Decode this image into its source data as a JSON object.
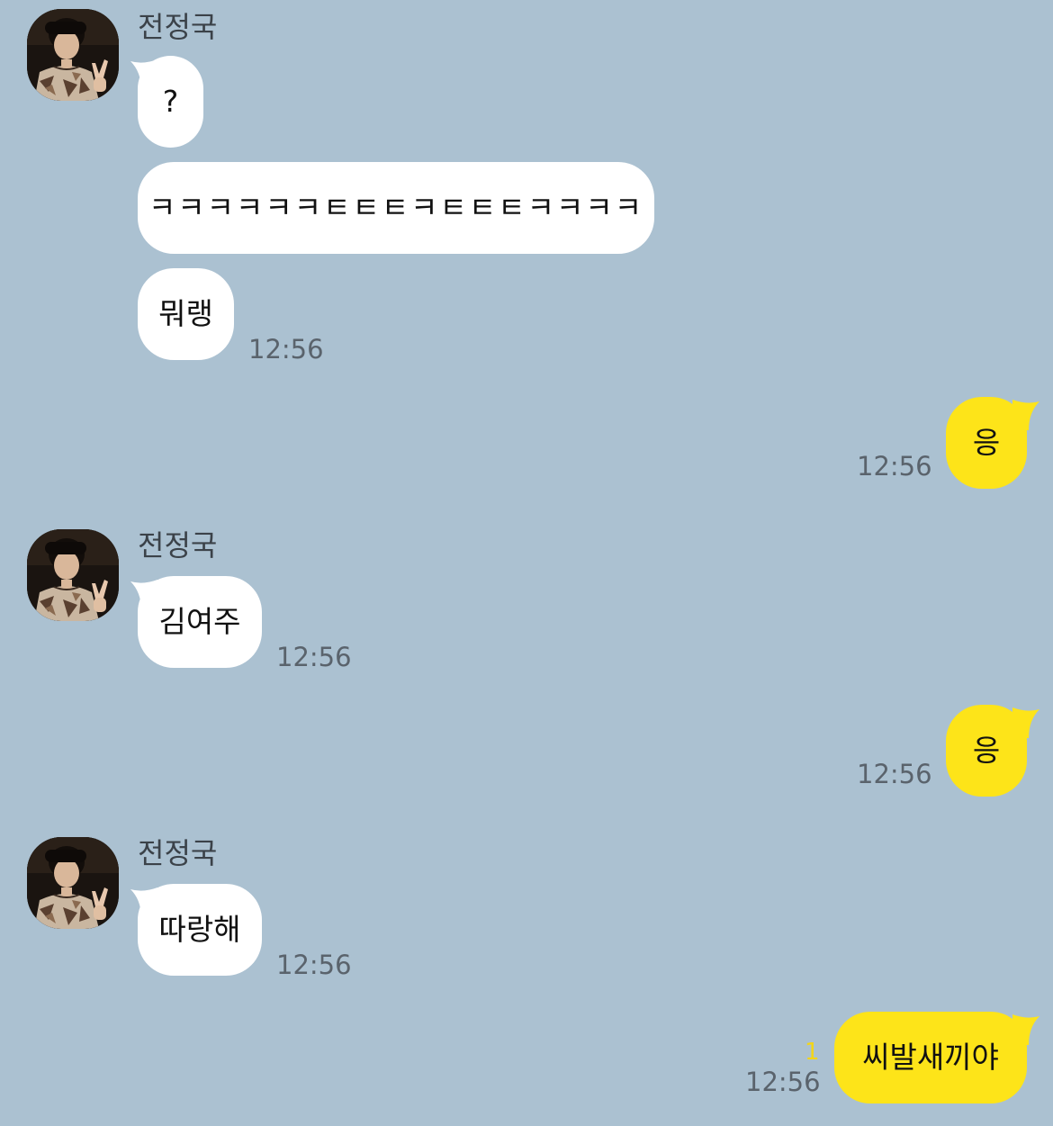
{
  "chat": {
    "sender_name": "전정국",
    "messages": [
      {
        "text": "?"
      },
      {
        "text": "ㅋㅋㅋㅋㅋㅋㅌㅌㅌㅋㅌㅌㅌㅋㅋㅋㅋ"
      },
      {
        "text": "뭐랭",
        "time": "12:56"
      },
      {
        "text": "응",
        "time": "12:56"
      },
      {
        "text": "김여주",
        "time": "12:56"
      },
      {
        "text": "응",
        "time": "12:56"
      },
      {
        "text": "따랑해",
        "time": "12:56"
      },
      {
        "text": "씨발새끼야",
        "time": "12:56",
        "unread": "1"
      }
    ]
  },
  "colors": {
    "background": "#abc1d1",
    "incoming_bubble": "#ffffff",
    "outgoing_bubble": "#fde419",
    "unread_count": "#f3d518"
  }
}
